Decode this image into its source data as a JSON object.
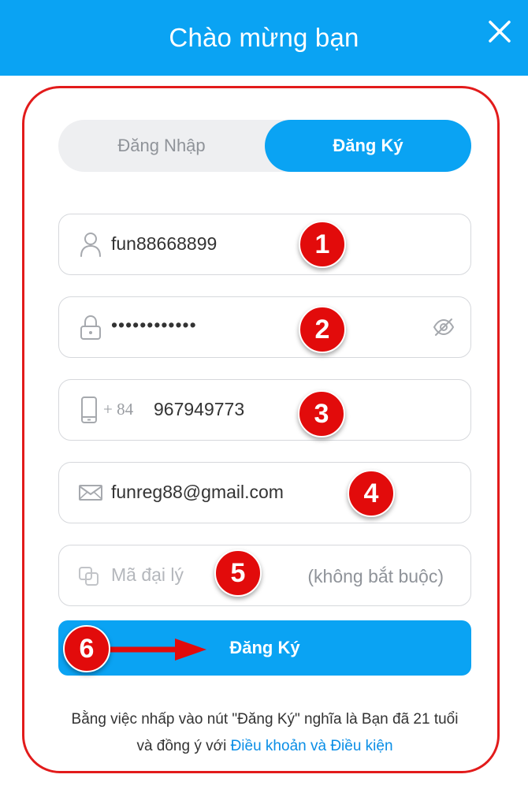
{
  "header": {
    "title": "Chào mừng bạn"
  },
  "tabs": {
    "login_label": "Đăng Nhập",
    "register_label": "Đăng Ký"
  },
  "form": {
    "username": {
      "value": "fun88668899"
    },
    "password": {
      "value": "••••••••••••"
    },
    "phone": {
      "prefix": "+ 84",
      "value": "967949773"
    },
    "email": {
      "value": "funreg88@gmail.com"
    },
    "agent_code": {
      "placeholder": "Mã đại lý",
      "hint": "(không bắt buộc)"
    },
    "submit_label": "Đăng Ký"
  },
  "badges": [
    "1",
    "2",
    "3",
    "4",
    "5",
    "6"
  ],
  "terms": {
    "line1": "Bằng việc nhấp vào nút \"Đăng Ký\" nghĩa là Bạn đã 21 tuổi",
    "line2_prefix": "và đồng ý với ",
    "link": "Điều khoản và Điều kiện"
  },
  "colors": {
    "accent": "#0aa3f3",
    "annotation_red": "#e20b0b",
    "frame_red": "#e21b1b"
  },
  "icons": [
    "close-icon",
    "user-icon",
    "lock-icon",
    "eye-off-icon",
    "phone-icon",
    "mail-icon",
    "agent-icon",
    "arrow-right-icon"
  ]
}
